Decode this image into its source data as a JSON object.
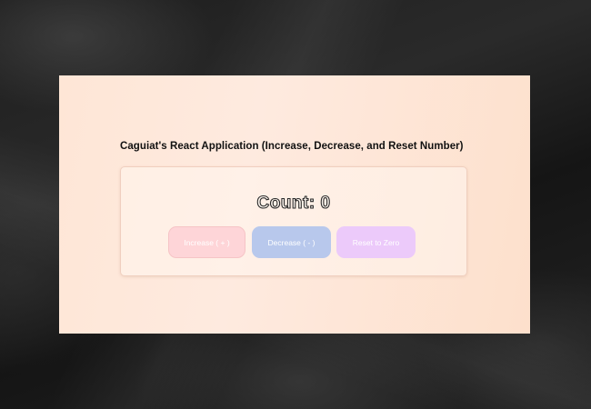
{
  "app": {
    "title": "Caguiat's React Application (Increase, Decrease, and Reset Number)"
  },
  "counter": {
    "label": "Count:",
    "value": 0,
    "display": "Count: 0"
  },
  "buttons": {
    "increase_label": "Increase ( + )",
    "decrease_label": "Decrease ( - )",
    "reset_label": "Reset to Zero"
  },
  "colors": {
    "page_background": "#1e1e1e",
    "panel_background": "#feeadf",
    "increase_button": "#fed5d8",
    "decrease_button": "#b8c8ec",
    "reset_button": "#eccafa"
  }
}
